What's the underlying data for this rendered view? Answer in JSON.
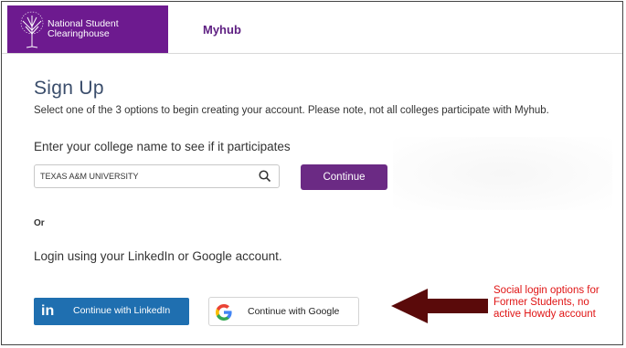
{
  "header": {
    "brand_lines": [
      "National Student",
      "Clearinghouse"
    ],
    "nav_link": "Myhub"
  },
  "signup": {
    "title": "Sign Up",
    "instructions": "Select one of the 3 options to begin creating your account. Please note, not all colleges participate with Myhub.",
    "college_label": "Enter your college name to see if it participates",
    "college_value": "TEXAS A&M UNIVERSITY",
    "continue_label": "Continue",
    "or_label": "Or",
    "social_label": "Login using your LinkedIn or Google account.",
    "linkedin_label": "Continue with LinkedIn",
    "google_label": "Continue with Google"
  },
  "annotation": {
    "lines": [
      "Social login options for",
      "Former Students, no",
      "active Howdy account"
    ],
    "color": "#e01515"
  },
  "colors": {
    "brand_purple": "#6d1a8f",
    "button_purple": "#6b2a84",
    "linkedin_blue": "#1f6fb0",
    "arrow_maroon": "#5a0a0a"
  }
}
